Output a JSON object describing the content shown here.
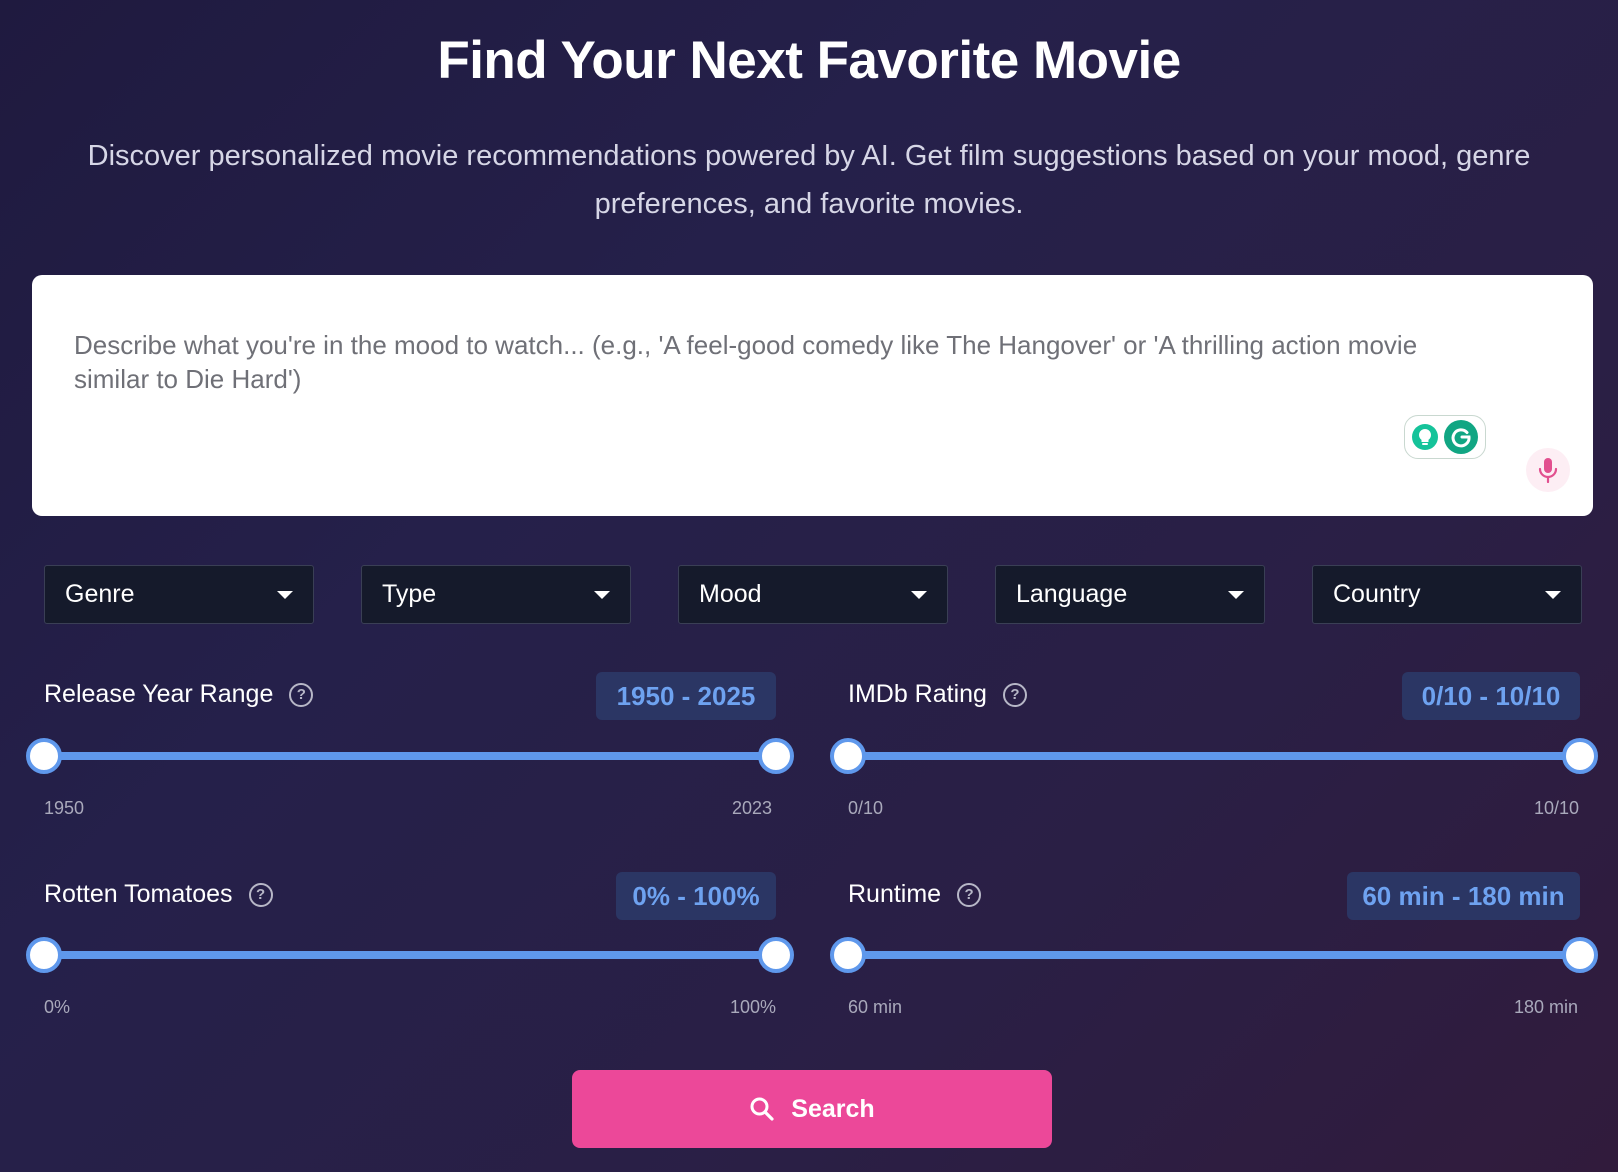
{
  "header": {
    "title": "Find Your Next Favorite Movie",
    "subtitle": "Discover personalized movie recommendations powered by AI. Get film suggestions based on your mood, genre preferences, and favorite movies."
  },
  "query": {
    "placeholder": "Describe what you're in the mood to watch... (e.g., 'A feel-good comedy like The Hangover' or 'A thrilling action movie similar to Die Hard')",
    "value": "",
    "icons": [
      "grammarly-suggestion-icon",
      "grammarly-icon",
      "microphone-icon"
    ]
  },
  "filters": {
    "genre": "Genre",
    "type": "Type",
    "mood": "Mood",
    "language": "Language",
    "country": "Country"
  },
  "sliders": {
    "year": {
      "label": "Release Year Range",
      "badge": "1950 - 2025",
      "min_label": "1950",
      "max_label": "2023",
      "low": 1950,
      "high": 2025
    },
    "imdb": {
      "label": "IMDb Rating",
      "badge": "0/10 - 10/10",
      "min_label": "0/10",
      "max_label": "10/10",
      "low": 0,
      "high": 10
    },
    "rt": {
      "label": "Rotten Tomatoes",
      "badge": "0% - 100%",
      "min_label": "0%",
      "max_label": "100%",
      "low": 0,
      "high": 100
    },
    "runtime": {
      "label": "Runtime",
      "badge": "60 min - 180 min",
      "min_label": "60 min",
      "max_label": "180 min",
      "low": 60,
      "high": 180
    }
  },
  "search": {
    "label": "Search"
  },
  "colors": {
    "accent": "#ec4899",
    "slider": "#5f98ec",
    "badge_text": "#6ea2f0",
    "badge_bg": "#2b3664",
    "dropdown_bg": "#151a2b"
  }
}
